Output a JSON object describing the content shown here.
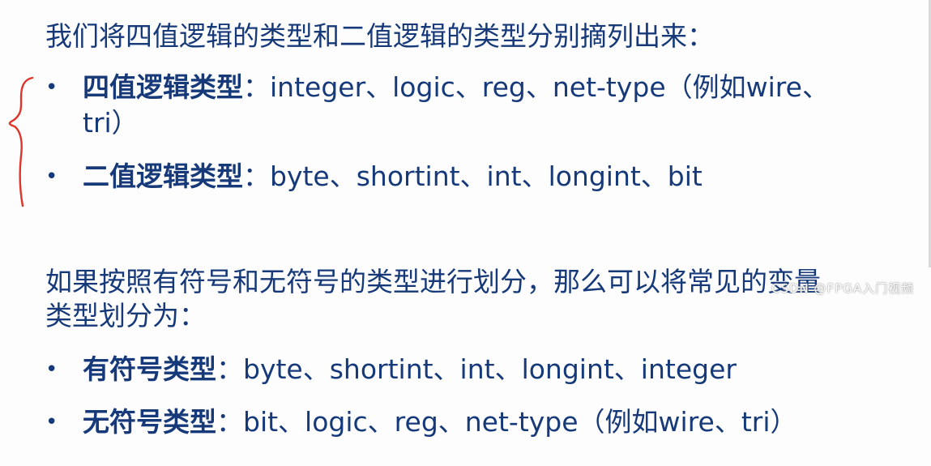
{
  "intro": "我们将四值逻辑的类型和二值逻辑的类型分别摘列出来：",
  "four_value": {
    "term": "四值逻辑类型",
    "sep": "：",
    "line1": "integer、logic、reg、net-type（例如wire、",
    "line2": "tri）"
  },
  "two_value": {
    "term": "二值逻辑类型",
    "sep": "：",
    "text": "byte、shortint、int、longint、bit"
  },
  "para2_line1": "如果按照有符号和无符号的类型进行划分，那么可以将常见的变量",
  "para2_line2": "类型划分为：",
  "signed": {
    "term": "有符号类型",
    "sep": "：",
    "text": "byte、shortint、int、longint、integer"
  },
  "unsigned": {
    "term": "无符号类型",
    "sep": "：",
    "text": "bit、logic、reg、net-type（例如wire、tri）"
  },
  "watermark": "CSDN @FPGA入门视频",
  "colors": {
    "text": "#16397a",
    "annotation": "#e0342a"
  }
}
